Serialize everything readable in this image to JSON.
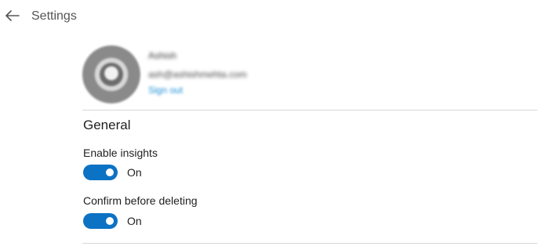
{
  "header": {
    "title": "Settings",
    "back_icon": "arrow-left-icon"
  },
  "profile": {
    "name": "Ashish",
    "email": "ash@ashishmehta.com",
    "sign_out_label": "Sign out",
    "avatar_icon": "avatar"
  },
  "general": {
    "section_title": "General",
    "settings": [
      {
        "label": "Enable insights",
        "state": "On",
        "enabled": true
      },
      {
        "label": "Confirm before deleting",
        "state": "On",
        "enabled": true
      }
    ]
  },
  "colors": {
    "toggle_on": "#0c72c4",
    "link": "#1b8fd6",
    "divider": "#d6d6d6"
  }
}
